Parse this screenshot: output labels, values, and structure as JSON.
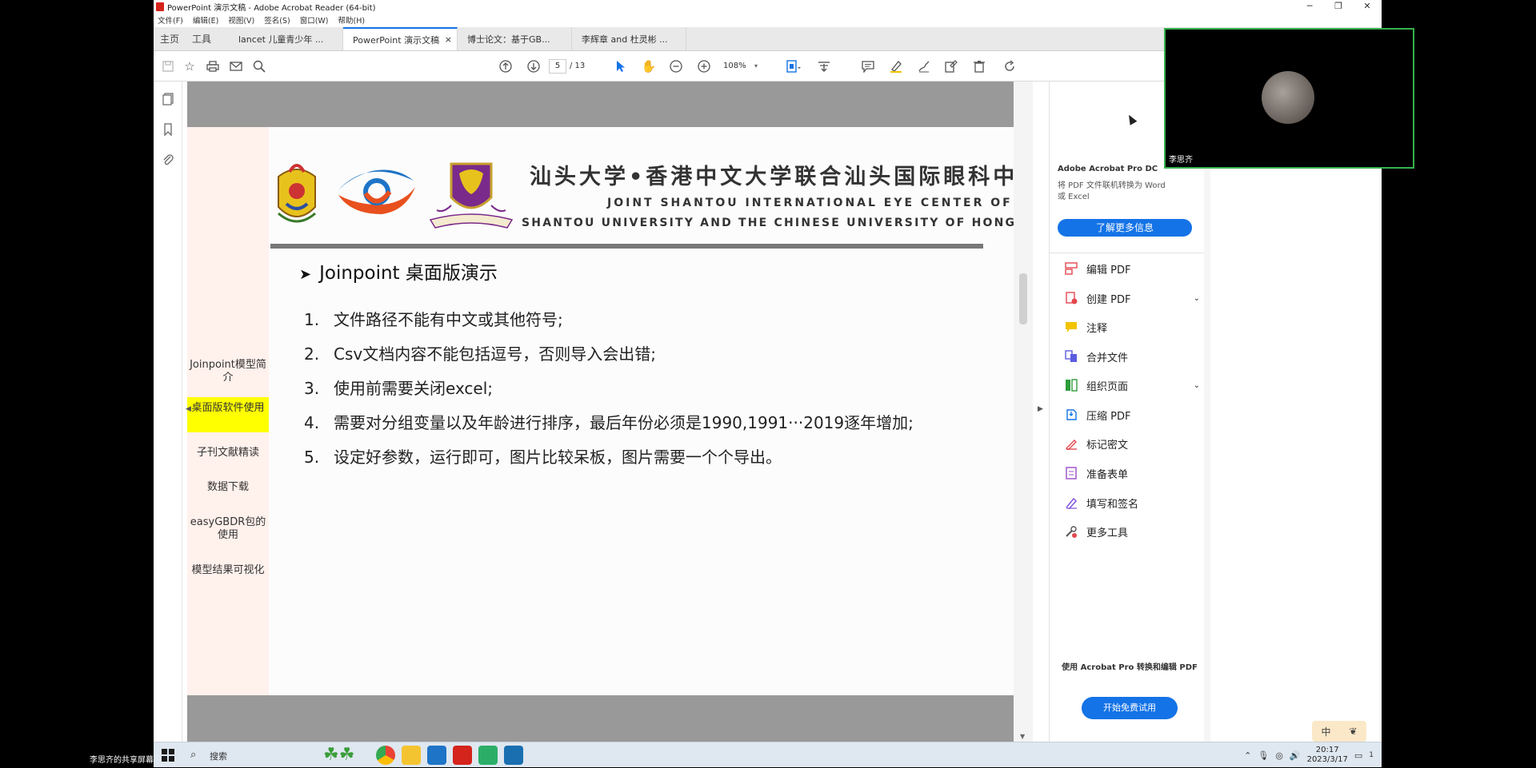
{
  "window": {
    "title": "PowerPoint 演示文稿 - Adobe Acrobat Reader (64-bit)",
    "minimize": "─",
    "maximize": "❐",
    "close": "✕"
  },
  "menu": [
    "文件(F)",
    "编辑(E)",
    "视图(V)",
    "签名(S)",
    "窗口(W)",
    "帮助(H)"
  ],
  "tabs": {
    "home": "主页",
    "tools": "工具",
    "docs": [
      {
        "label": "lancet 儿童青少年 ..."
      },
      {
        "label": "PowerPoint 演示文稿",
        "close": "×"
      },
      {
        "label": "博士论文：基于GB..."
      },
      {
        "label": "李辉章 and 杜灵彬 ..."
      }
    ]
  },
  "toolbar": {
    "page_current": "5",
    "page_total": "/ 13",
    "zoom": "108%"
  },
  "slide": {
    "nav": [
      "Joinpoint模型简介",
      "桌面版软件使用",
      "子刊文献精读",
      "数据下载",
      "easyGBDR包的使用",
      "模型结果可视化"
    ],
    "header_cn": "汕头大学•香港中文大学联合汕头国际眼科中心",
    "header_en1": "JOINT SHANTOU INTERNATIONAL EYE CENTER  OF",
    "header_en2": "SHANTOU UNIVERSITY AND THE CHINESE UNIVERSITY OF HONG KONG",
    "title": "Joinpoint 桌面版演示",
    "points": [
      {
        "num": "1.",
        "text": "文件路径不能有中文或其他符号;"
      },
      {
        "num": "2.",
        "text": "Csv文档内容不能包括逗号，否则导入会出错;"
      },
      {
        "num": "3.",
        "text": "使用前需要关闭excel;"
      },
      {
        "num": "4.",
        "text": "需要对分组变量以及年龄进行排序，最后年份必须是1990,1991···2019逐年增加;"
      },
      {
        "num": "5.",
        "text": "设定好参数，运行即可，图片比较呆板，图片需要一个个导出。"
      }
    ]
  },
  "tools_pane": {
    "product": "Adobe Acrobat Pro DC",
    "desc": "将 PDF 文件联机转换为 Word 或 Excel",
    "learn_more": "了解更多信息",
    "tools": [
      {
        "label": "编辑 PDF",
        "icon": "edit-pdf-icon",
        "color": "#e34850"
      },
      {
        "label": "创建 PDF",
        "icon": "create-pdf-icon",
        "color": "#e34850",
        "expand": true
      },
      {
        "label": "注释",
        "icon": "comment-icon",
        "color": "#f2c300"
      },
      {
        "label": "合并文件",
        "icon": "combine-icon",
        "color": "#5c5ce0"
      },
      {
        "label": "组织页面",
        "icon": "organize-icon",
        "color": "#2d9d3a",
        "expand": true
      },
      {
        "label": "压缩 PDF",
        "icon": "compress-icon",
        "color": "#1473e6"
      },
      {
        "label": "标记密文",
        "icon": "redact-icon",
        "color": "#e34850"
      },
      {
        "label": "准备表单",
        "icon": "form-icon",
        "color": "#9b4dca"
      },
      {
        "label": "填写和签名",
        "icon": "sign-icon",
        "color": "#7b4cd6"
      },
      {
        "label": "更多工具",
        "icon": "more-tools-icon",
        "color": "#555555"
      }
    ],
    "promo": "使用 Acrobat Pro 转换和编辑 PDF",
    "trial": "开始免费试用"
  },
  "video": {
    "name": "李思齐"
  },
  "ime": {
    "lang": "中",
    "mode": "❦"
  },
  "taskbar": {
    "search": "搜索",
    "time": "20:17",
    "date": "2023/3/17",
    "notif_count": "1"
  },
  "share_label": "李思齐的共享屏幕",
  "colors": {
    "accent": "#1473e6",
    "highlight": "#ffff00",
    "video_border": "#37b24d"
  }
}
